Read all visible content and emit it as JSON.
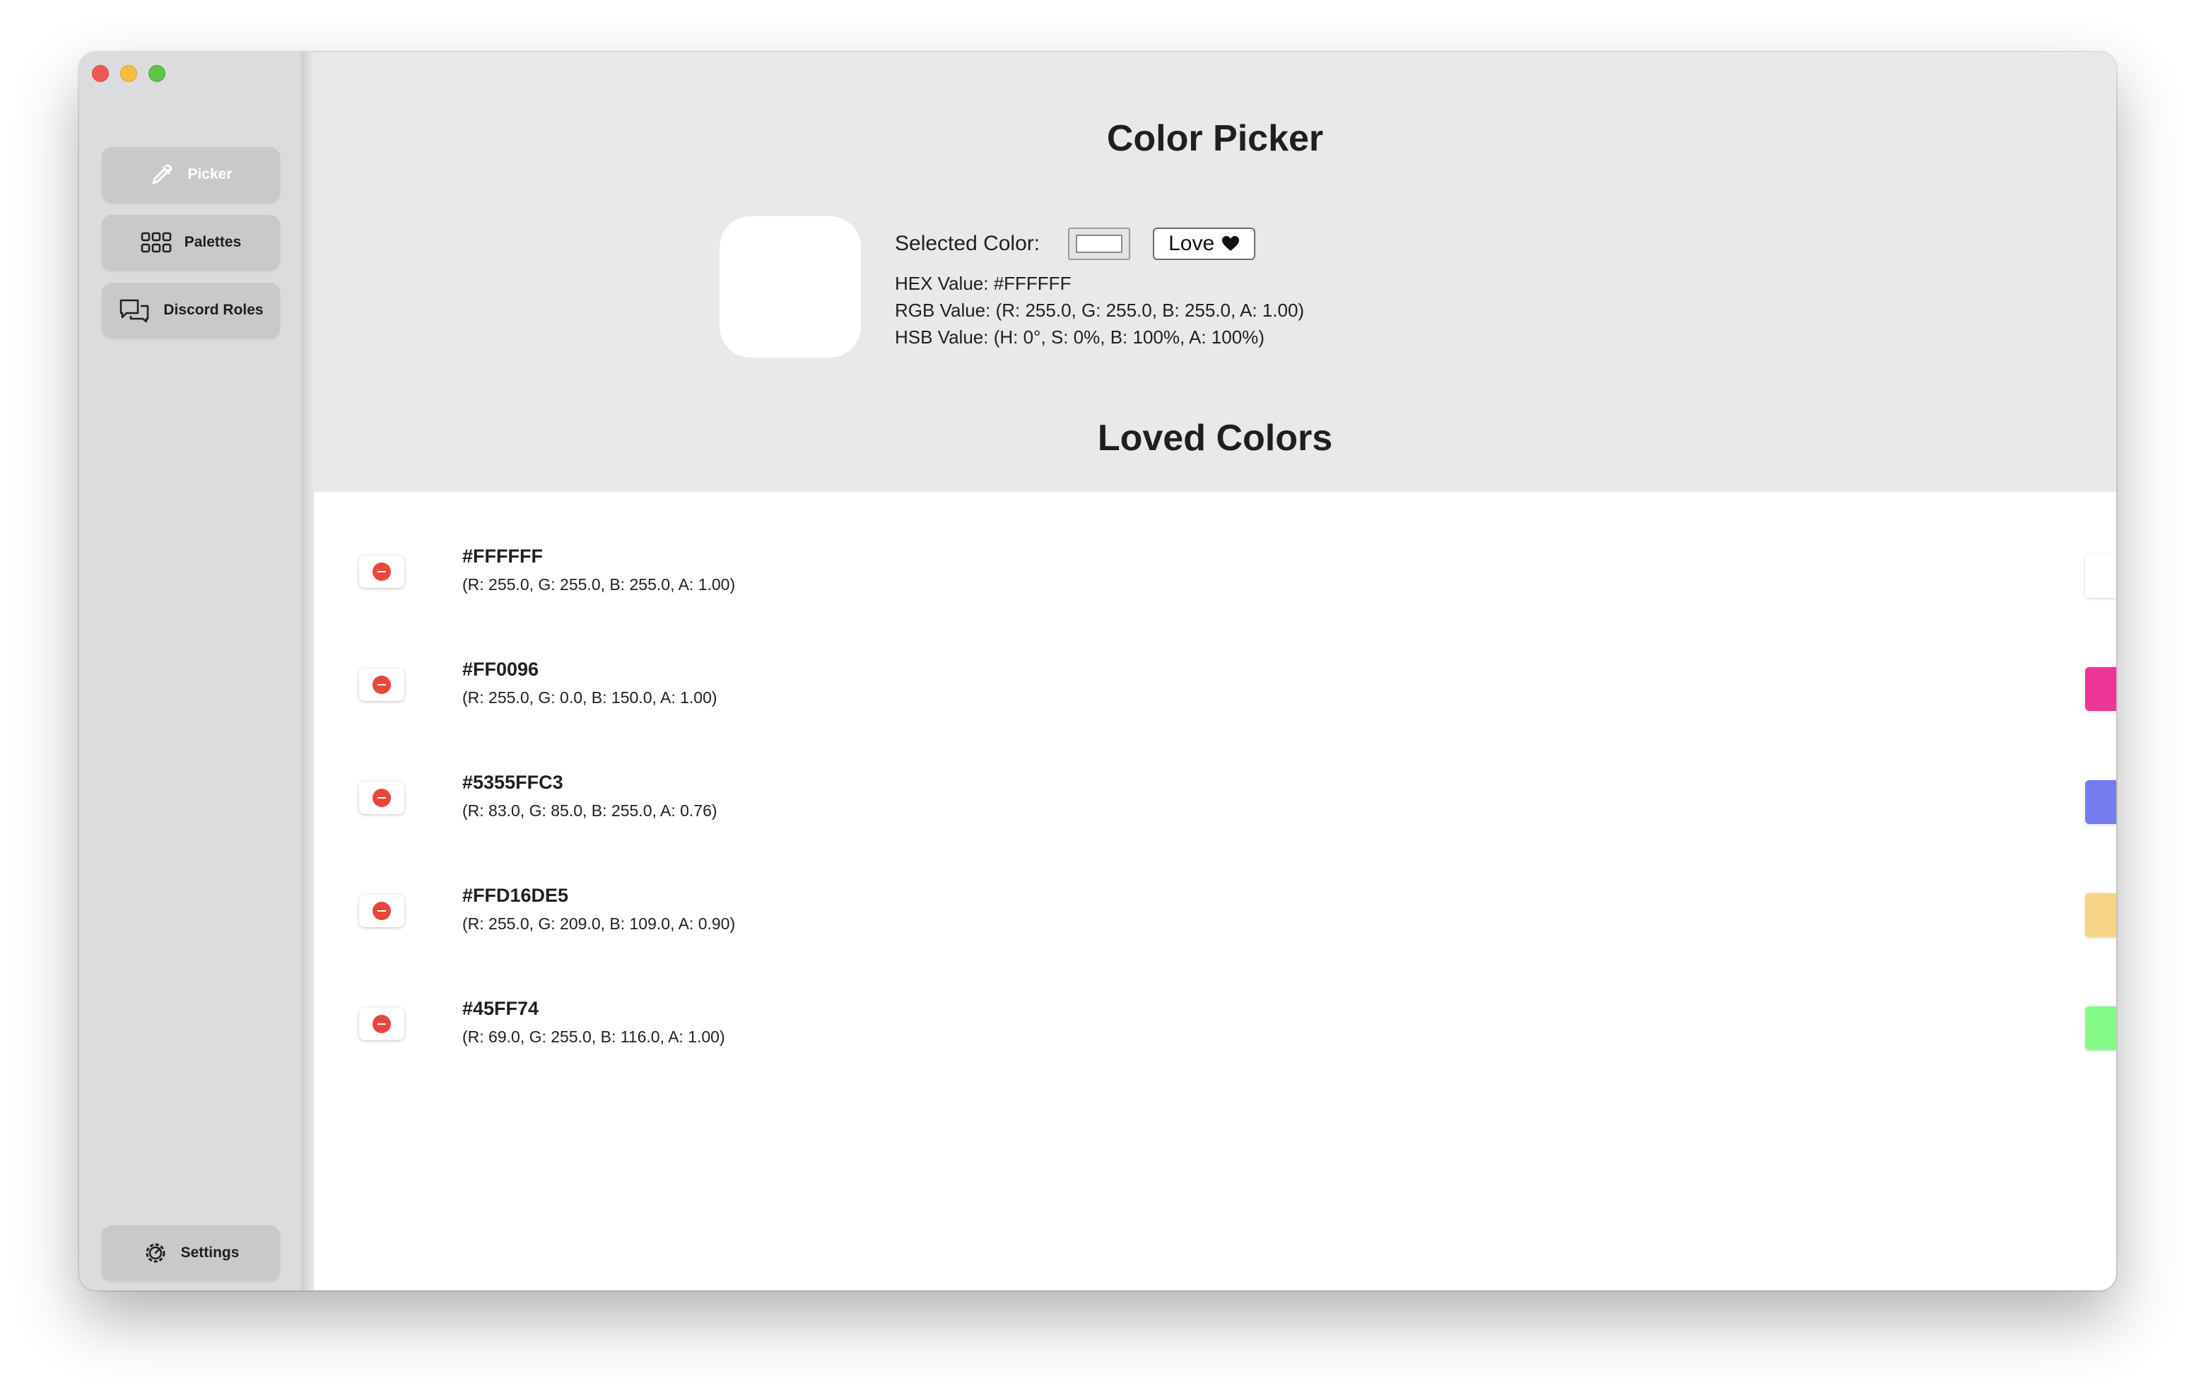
{
  "sidebar": {
    "items": [
      {
        "label": "Picker",
        "icon": "eyedropper-icon",
        "active": true
      },
      {
        "label": "Palettes",
        "icon": "grid-icon",
        "active": false
      },
      {
        "label": "Discord Roles",
        "icon": "chat-bubbles-icon",
        "active": false
      }
    ],
    "settings": {
      "label": "Settings",
      "icon": "gear-icon"
    }
  },
  "picker": {
    "title": "Color Picker",
    "selected_label": "Selected Color:",
    "love_label": "Love",
    "hex_line": "HEX Value: #FFFFFF",
    "rgb_line": "RGB Value: (R: 255.0, G: 255.0, B: 255.0, A: 1.00)",
    "hsb_line": "HSB Value: (H: 0°, S: 0%, B: 100%, A: 100%)",
    "selected_color": "#FFFFFF"
  },
  "loved": {
    "title": "Loved Colors",
    "items": [
      {
        "hex": "#FFFFFF",
        "rgb": "(R: 255.0, G: 255.0, B: 255.0, A: 1.00)",
        "color": "#FFFFFF"
      },
      {
        "hex": "#FF0096",
        "rgb": "(R: 255.0, G: 0.0, B: 150.0, A: 1.00)",
        "color": "#EC3596"
      },
      {
        "hex": "#5355FFC3",
        "rgb": "(R: 83.0, G: 85.0, B: 255.0, A: 0.76)",
        "color": "#737BEE"
      },
      {
        "hex": "#FFD16DE5",
        "rgb": "(R: 255.0, G: 209.0, B: 109.0, A: 0.90)",
        "color": "#F5D487"
      },
      {
        "hex": "#45FF74",
        "rgb": "(R: 69.0, G: 255.0, B: 116.0, A: 1.00)",
        "color": "#86FA86"
      }
    ]
  }
}
